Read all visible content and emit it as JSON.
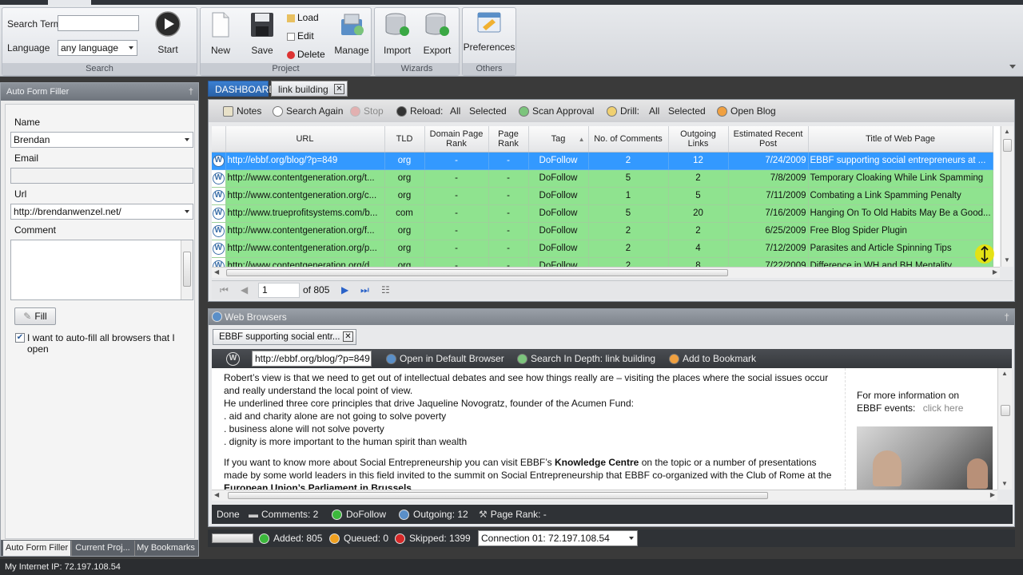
{
  "ribbon": {
    "search": {
      "term_label": "Search Term",
      "term_value": "",
      "language_label": "Language",
      "language_value": "any language",
      "start_label": "Start",
      "group_title": "Search"
    },
    "project": {
      "new_label": "New",
      "save_label": "Save",
      "load_label": "Load",
      "edit_label": "Edit",
      "delete_label": "Delete",
      "manage_label": "Manage",
      "group_title": "Project"
    },
    "wizards": {
      "import_label": "Import",
      "export_label": "Export",
      "group_title": "Wizards"
    },
    "others": {
      "preferences_label": "Preferences",
      "group_title": "Others"
    }
  },
  "left_panel": {
    "title": "Auto Form Filler",
    "name_label": "Name",
    "name_value": "Brendan",
    "email_label": "Email",
    "email_value": "",
    "url_label": "Url",
    "url_value": "http://brendanwenzel.net/",
    "comment_label": "Comment",
    "comment_value": "",
    "fill_label": "Fill",
    "autofill_label": "I want to auto-fill all browsers that I open",
    "tabs": [
      "Auto Form Filler",
      "Current Proj...",
      "My Bookmarks"
    ]
  },
  "doc_tabs": [
    "DASHBOARD",
    "link building"
  ],
  "grid_toolbar": {
    "notes": "Notes",
    "search_again": "Search Again",
    "stop": "Stop",
    "reload": "Reload:",
    "reload_all": "All",
    "reload_selected": "Selected",
    "scan_approval": "Scan Approval",
    "drill": "Drill:",
    "drill_all": "All",
    "drill_selected": "Selected",
    "open_blog": "Open Blog"
  },
  "grid": {
    "columns": [
      "URL",
      "TLD",
      "Domain Page Rank",
      "Page Rank",
      "Tag",
      "No. of Comments",
      "Outgoing Links",
      "Estimated Recent Post",
      "Title of Web Page"
    ],
    "rows": [
      [
        "http://ebbf.org/blog/?p=849",
        "org",
        "-",
        "-",
        "DoFollow",
        "2",
        "12",
        "7/24/2009",
        "EBBF supporting social entrepreneurs at ..."
      ],
      [
        "http://www.contentgeneration.org/t...",
        "org",
        "-",
        "-",
        "DoFollow",
        "5",
        "2",
        "7/8/2009",
        "Temporary Cloaking While Link Spamming"
      ],
      [
        "http://www.contentgeneration.org/c...",
        "org",
        "-",
        "-",
        "DoFollow",
        "1",
        "5",
        "7/11/2009",
        "Combating a Link Spamming Penalty"
      ],
      [
        "http://www.trueprofitsystems.com/b...",
        "com",
        "-",
        "-",
        "DoFollow",
        "5",
        "20",
        "7/16/2009",
        "Hanging On To Old Habits May Be a Good..."
      ],
      [
        "http://www.contentgeneration.org/f...",
        "org",
        "-",
        "-",
        "DoFollow",
        "2",
        "2",
        "6/25/2009",
        "Free Blog Spider Plugin"
      ],
      [
        "http://www.contentgeneration.org/p...",
        "org",
        "-",
        "-",
        "DoFollow",
        "2",
        "4",
        "7/12/2009",
        "Parasites and Article Spinning Tips"
      ],
      [
        "http://www.contentgeneration.org/d...",
        "org",
        "-",
        "-",
        "DoFollow",
        "2",
        "8",
        "7/22/2009",
        "Difference in WH and BH Mentality"
      ]
    ],
    "pager_page": "1",
    "pager_total": "of 805"
  },
  "browser": {
    "panel_title": "Web Browsers",
    "tab_title": "EBBF supporting social entr...",
    "address": "http://ebbf.org/blog/?p=849",
    "open_default": "Open in Default Browser",
    "search_depth": "Search In Depth: link building",
    "add_bookmark": "Add to Bookmark",
    "content": {
      "p1": "Robert’s view is that we need to get out of intellectual debates and see how things really are – visiting the places where the social issues occur and really understand the local point of view.",
      "p2": "He underlined three core principles that drive Jaqueline Novogratz, founder of the Acumen Fund:",
      "l1": ". aid and charity alone are not going to solve poverty",
      "l2": ". business alone will not solve poverty",
      "l3": ". dignity is more important to the human spirit than wealth",
      "p3a": "If you want to know more about Social Entrepreneurship you can visit EBBF’s ",
      "p3b": "Knowledge Centre",
      "p3c": " on the topic or a number of presentations made by some world leaders in this field invited to the summit on Social Entrepreneurship that EBBF co-organized with the Club of Rome at the ",
      "p3d": "European Union’s Parliament in Brussels",
      "side1": "For more information on EBBF events:",
      "side_link": "click here"
    },
    "status": {
      "done": "Done",
      "comments": "Comments: 2",
      "dofollow": "DoFollow",
      "outgoing": "Outgoing: 12",
      "pagerank": "Page Rank: -"
    }
  },
  "statusbar": {
    "added": "Added: 805",
    "queued": "Queued: 0",
    "skipped": "Skipped: 1399",
    "connection": "Connection 01: 72.197.108.54"
  },
  "footer": {
    "ip": "My Internet IP:  72.197.108.54"
  },
  "colors": {
    "row_green": "#8fe38f",
    "row_selected": "#3399ff",
    "added": "#3cb83c",
    "queued": "#f0a020",
    "skipped": "#d62828"
  }
}
